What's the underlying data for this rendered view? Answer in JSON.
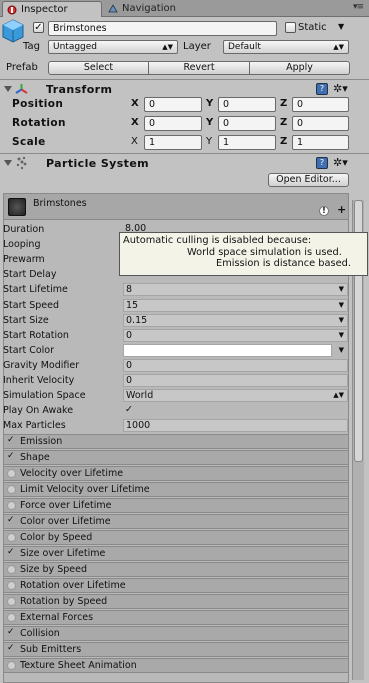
{
  "tabs": [
    {
      "label": "Inspector",
      "icon": "inspector-icon"
    },
    {
      "label": "Navigation",
      "icon": "navigation-icon"
    }
  ],
  "header": {
    "object_name": "Brimstones",
    "static_label": "Static",
    "tag_label": "Tag",
    "tag_value": "Untagged",
    "layer_label": "Layer",
    "layer_value": "Default",
    "prefab_label": "Prefab",
    "prefab_buttons": [
      "Select",
      "Revert",
      "Apply"
    ]
  },
  "transform": {
    "title": "Transform",
    "rows": [
      {
        "label": "Position",
        "x": "0",
        "y": "0",
        "z": "0"
      },
      {
        "label": "Rotation",
        "x": "0",
        "y": "0",
        "z": "0"
      },
      {
        "label": "Scale",
        "x": "1",
        "y": "1",
        "z": "1"
      }
    ],
    "axis_labels": [
      "X",
      "Y",
      "Z"
    ]
  },
  "particle_system": {
    "title": "Particle System",
    "open_editor_label": "Open Editor...",
    "module_name": "Brimstones",
    "properties": [
      {
        "label": "Duration",
        "value": "8.00"
      },
      {
        "label": "Looping",
        "value": ""
      },
      {
        "label": "Prewarm",
        "value": ""
      },
      {
        "label": "Start Delay",
        "value": ""
      },
      {
        "label": "Start Lifetime",
        "value": "8"
      },
      {
        "label": "Start Speed",
        "value": "15"
      },
      {
        "label": "Start Size",
        "value": "0.15"
      },
      {
        "label": "Start Rotation",
        "value": "0"
      },
      {
        "label": "Start Color",
        "value": ""
      },
      {
        "label": "Gravity Modifier",
        "value": "0"
      },
      {
        "label": "Inherit Velocity",
        "value": "0"
      },
      {
        "label": "Simulation Space",
        "value": "World"
      },
      {
        "label": "Play On Awake",
        "value": "✓"
      },
      {
        "label": "Max Particles",
        "value": "1000"
      }
    ],
    "modules": [
      {
        "label": "Emission",
        "enabled": true
      },
      {
        "label": "Shape",
        "enabled": true
      },
      {
        "label": "Velocity over Lifetime",
        "enabled": false
      },
      {
        "label": "Limit Velocity over Lifetime",
        "enabled": false
      },
      {
        "label": "Force over Lifetime",
        "enabled": false
      },
      {
        "label": "Color over Lifetime",
        "enabled": true
      },
      {
        "label": "Color by Speed",
        "enabled": false
      },
      {
        "label": "Size over Lifetime",
        "enabled": true
      },
      {
        "label": "Size by Speed",
        "enabled": false
      },
      {
        "label": "Rotation over Lifetime",
        "enabled": false
      },
      {
        "label": "Rotation by Speed",
        "enabled": false
      },
      {
        "label": "External Forces",
        "enabled": false
      },
      {
        "label": "Collision",
        "enabled": true
      },
      {
        "label": "Sub Emitters",
        "enabled": true
      },
      {
        "label": "Texture Sheet Animation",
        "enabled": false
      }
    ]
  },
  "tooltip": {
    "line1": "Automatic culling is disabled because:",
    "line2": "World space simulation is used.",
    "line3": "Emission is distance based."
  }
}
